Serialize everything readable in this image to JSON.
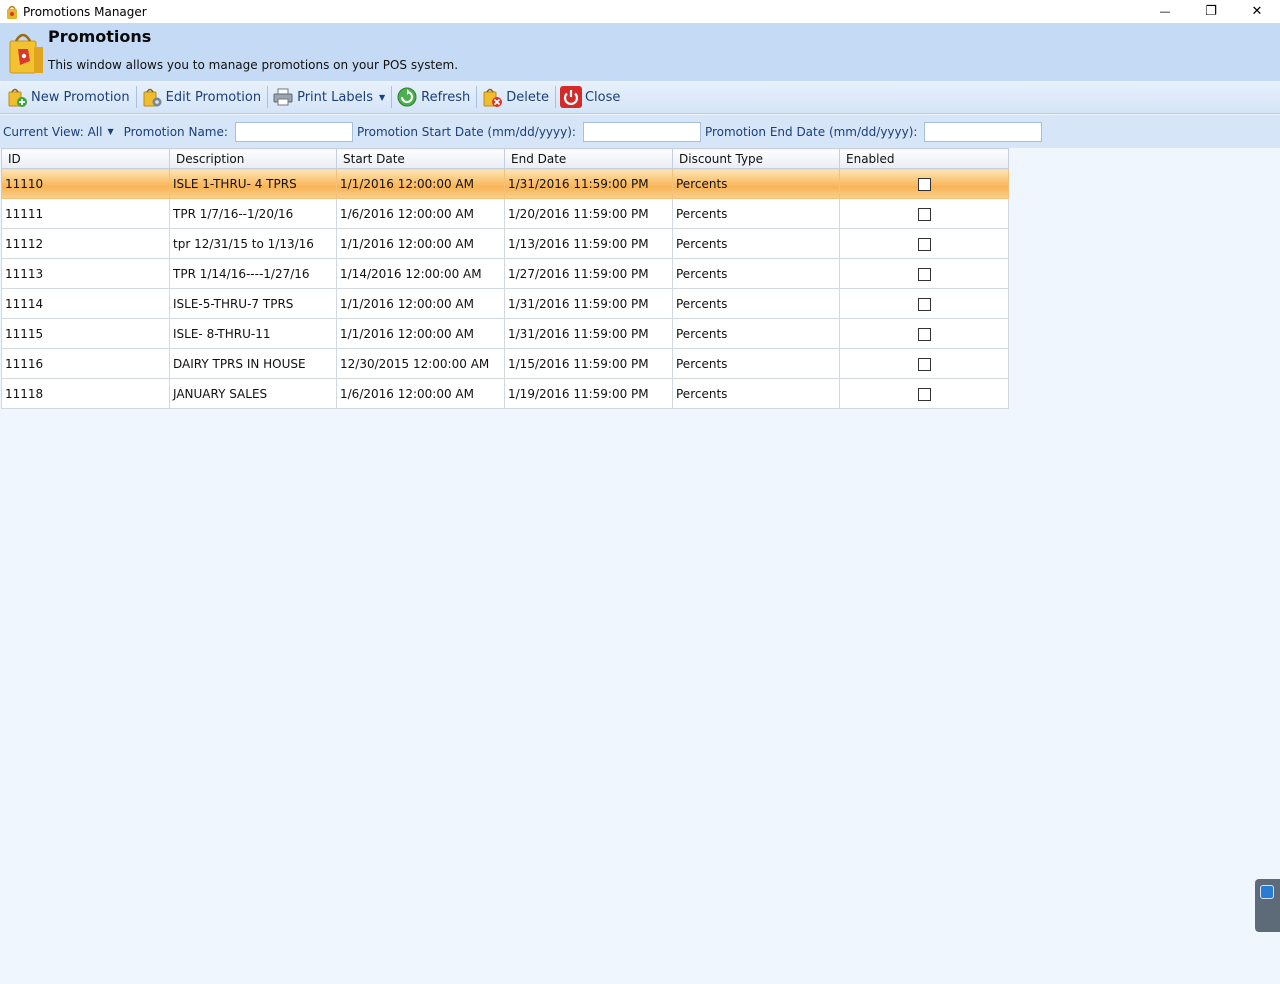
{
  "window": {
    "title": "Promotions Manager",
    "minimize_glyph": "—",
    "restore_glyph": "❐",
    "close_glyph": "✕"
  },
  "header": {
    "title": "Promotions",
    "subtitle": "This window allows you to manage promotions on your POS system."
  },
  "toolbar": {
    "new_label": "New Promotion",
    "edit_label": "Edit Promotion",
    "print_label": "Print Labels",
    "refresh_label": "Refresh",
    "delete_label": "Delete",
    "close_label": "Close"
  },
  "filters": {
    "current_view_label": "Current View: All",
    "name_label": "Promotion Name:",
    "name_value": "",
    "start_label": "Promotion Start Date (mm/dd/yyyy):",
    "start_value": "",
    "end_label": "Promotion End Date (mm/dd/yyyy):",
    "end_value": ""
  },
  "grid": {
    "columns": [
      "ID",
      "Description",
      "Start Date",
      "End Date",
      "Discount Type",
      "Enabled"
    ],
    "rows": [
      {
        "id": "11110",
        "description": "ISLE 1-THRU- 4 TPRS",
        "start": "1/1/2016 12:00:00 AM",
        "end": "1/31/2016 11:59:00 PM",
        "type": "Percents",
        "enabled": false,
        "selected": true
      },
      {
        "id": "11111",
        "description": "TPR 1/7/16--1/20/16",
        "start": "1/6/2016 12:00:00 AM",
        "end": "1/20/2016 11:59:00 PM",
        "type": "Percents",
        "enabled": false,
        "selected": false
      },
      {
        "id": "11112",
        "description": "tpr 12/31/15 to 1/13/16",
        "start": "1/1/2016 12:00:00 AM",
        "end": "1/13/2016 11:59:00 PM",
        "type": "Percents",
        "enabled": false,
        "selected": false
      },
      {
        "id": "11113",
        "description": "TPR 1/14/16----1/27/16",
        "start": "1/14/2016 12:00:00 AM",
        "end": "1/27/2016 11:59:00 PM",
        "type": "Percents",
        "enabled": false,
        "selected": false
      },
      {
        "id": "11114",
        "description": "ISLE-5-THRU-7 TPRS",
        "start": "1/1/2016 12:00:00 AM",
        "end": "1/31/2016 11:59:00 PM",
        "type": "Percents",
        "enabled": false,
        "selected": false
      },
      {
        "id": "11115",
        "description": "ISLE- 8-THRU-11",
        "start": "1/1/2016 12:00:00 AM",
        "end": "1/31/2016 11:59:00 PM",
        "type": "Percents",
        "enabled": false,
        "selected": false
      },
      {
        "id": "11116",
        "description": "DAIRY TPRS IN HOUSE",
        "start": "12/30/2015 12:00:00 AM",
        "end": "1/15/2016 11:59:00 PM",
        "type": "Percents",
        "enabled": false,
        "selected": false
      },
      {
        "id": "11118",
        "description": "JANUARY SALES",
        "start": "1/6/2016 12:00:00 AM",
        "end": "1/19/2016 11:59:00 PM",
        "type": "Percents",
        "enabled": false,
        "selected": false
      }
    ]
  },
  "colors": {
    "header_bg": "#c5daf4",
    "toolbar_text": "#1b3f7a",
    "selection": "#f9b455",
    "body_bg": "#f0f6fd"
  }
}
